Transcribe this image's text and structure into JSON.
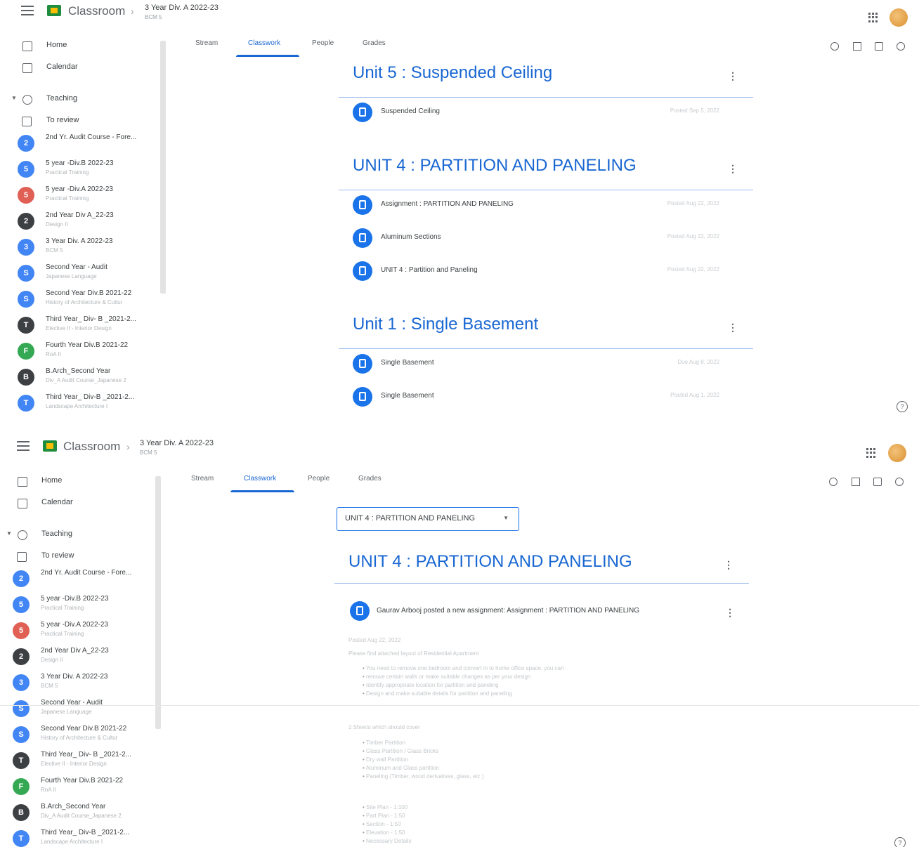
{
  "app": {
    "name": "Classroom",
    "breadcrumb_title": "3 Year Div. A 2022-23",
    "breadcrumb_sub": "BCM 5"
  },
  "nav": {
    "home": "Home",
    "calendar": "Calendar",
    "teaching": "Teaching",
    "to_review": "To review"
  },
  "courses": [
    {
      "initial": "2",
      "name": "2nd Yr. Audit Course - Fore...",
      "sub": "",
      "color": "#4285f4"
    },
    {
      "initial": "5",
      "name": "5 year -Div.B 2022-23",
      "sub": "Practical Training",
      "color": "#4285f4"
    },
    {
      "initial": "5",
      "name": "5 year -Div.A 2022-23",
      "sub": "Practical Training",
      "color": "#e06055"
    },
    {
      "initial": "2",
      "name": "2nd Year Div A_22-23",
      "sub": "Design II",
      "color": "#3c4043"
    },
    {
      "initial": "3",
      "name": "3 Year Div. A 2022-23",
      "sub": "BCM 5",
      "color": "#4285f4"
    },
    {
      "initial": "S",
      "name": "Second Year - Audit",
      "sub": "Japanese Language",
      "color": "#4285f4"
    },
    {
      "initial": "S",
      "name": "Second Year Div.B 2021-22",
      "sub": "History of Architecture & Cultur",
      "color": "#4285f4"
    },
    {
      "initial": "T",
      "name": "Third Year_ Div- B _2021-2...",
      "sub": "Elective II - Interior Design",
      "color": "#3c4043"
    },
    {
      "initial": "F",
      "name": "Fourth Year Div.B 2021-22",
      "sub": "RoA II",
      "color": "#34a853"
    },
    {
      "initial": "B",
      "name": "B.Arch_Second Year",
      "sub": "Div_A Audit Course_Japanese 2",
      "color": "#3c4043"
    },
    {
      "initial": "T",
      "name": "Third Year_ Div-B _2021-2...",
      "sub": "Landscape Architecture I",
      "color": "#4285f4"
    }
  ],
  "tabs": {
    "stream": "Stream",
    "classwork": "Classwork",
    "people": "People",
    "grades": "Grades"
  },
  "topics": [
    {
      "title": "Unit 5 : Suspended Ceiling",
      "items": [
        {
          "label": "Suspended Ceiling",
          "date": "Posted Sep 5, 2022"
        }
      ]
    },
    {
      "title": "UNIT 4 : PARTITION AND PANELING",
      "items": [
        {
          "label": "Assignment : PARTITION AND PANELING",
          "date": "Posted Aug 22, 2022"
        },
        {
          "label": "Aluminum Sections",
          "date": "Posted Aug 22, 2022"
        },
        {
          "label": "UNIT 4 : Partition and Paneling",
          "date": "Posted Aug 22, 2022"
        }
      ]
    },
    {
      "title": "Unit 1 : Single Basement",
      "items": [
        {
          "label": "Single Basement",
          "date": "Due Aug 8, 2022"
        },
        {
          "label": "Single Basement",
          "date": "Posted Aug 1, 2022"
        }
      ]
    }
  ],
  "filter": {
    "selected": "UNIT 4 : PARTITION AND PANELING"
  },
  "detail": {
    "topic_title": "UNIT 4 : PARTITION AND PANELING",
    "post_text": "Gaurav Arbooj posted a new assignment: Assignment : PARTITION AND PANELING",
    "posted": "Posted Aug 22, 2022",
    "instructions": "Please find attached layout of Residential Apartment",
    "bullets1": [
      "You need to remove one bedroom and convert in to home office space. you can",
      "remove certain walls or make suitable changes as per your design",
      "Identify appropriate location for partition and paneling",
      "Design and make suitable details for partition and paneling"
    ],
    "sheets_intro": "2 Sheets which should cover",
    "bullets2": [
      "Timber Partition",
      "Glass Partition / Glass Bricks",
      "Dry wall Partition",
      "Aluminum and Glass partition",
      "Paneling (Timber, wood derivatives, glass, etc )"
    ],
    "bullets3": [
      "Site Plan - 1:100",
      "Part Plan - 1:50",
      "Section - 1:50",
      "Elevation - 1:50",
      "Necessary Details"
    ]
  },
  "icons": [
    "menu-icon",
    "classroom-logo-icon",
    "apps-grid-icon",
    "avatar",
    "home-icon",
    "calendar-icon",
    "teaching-icon",
    "to-review-icon",
    "google-calendar-icon",
    "drive-icon",
    "settings-icon",
    "meet-icon",
    "help-icon",
    "more-vert-icon",
    "assignment-icon"
  ],
  "colors": {
    "accent": "#1967d2",
    "logo_green": "#1e8e3e",
    "logo_yellow": "#fbbc04"
  }
}
